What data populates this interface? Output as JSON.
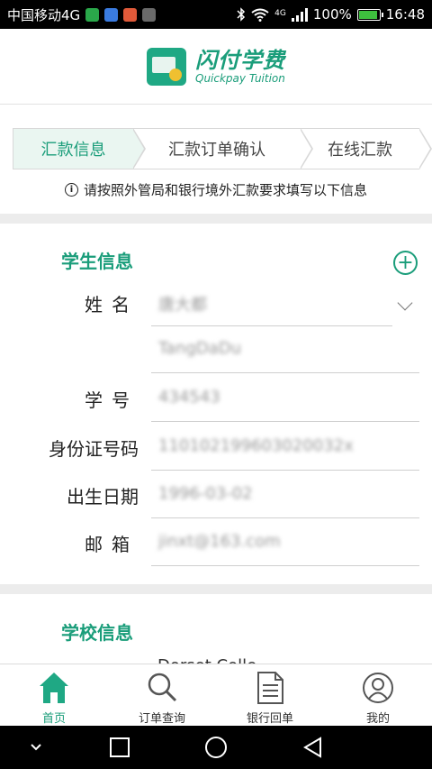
{
  "statusbar": {
    "carrier": "中国移动4G",
    "signal_label": "4G",
    "battery": "100%",
    "time": "16:48",
    "app_icon_colors": [
      "#2aa84a",
      "#3a7be0",
      "#e05a3a",
      "#6a6a6a"
    ]
  },
  "header": {
    "logo_cn": "闪付学费",
    "logo_en": "Quickpay Tuition"
  },
  "steps": [
    {
      "label": "汇款信息",
      "active": true
    },
    {
      "label": "汇款订单确认",
      "active": false
    },
    {
      "label": "在线汇款",
      "active": false
    }
  ],
  "notice": {
    "icon_text": "i",
    "text": "请按照外管局和银行境外汇款要求填写以下信息"
  },
  "student_section": {
    "title": "学生信息",
    "add_symbol": "+",
    "fields": [
      {
        "key": "name",
        "label": "姓名",
        "value": "唐大都"
      },
      {
        "key": "pinyin",
        "label": "",
        "value": "TangDaDu"
      },
      {
        "key": "student_id",
        "label": "学号",
        "value": "434543"
      },
      {
        "key": "id_number",
        "label": "身份证号码",
        "value": "110102199603020032x"
      },
      {
        "key": "birthdate",
        "label": "出生日期",
        "value": "1996-03-02"
      },
      {
        "key": "email",
        "label": "邮箱",
        "value": "jinxt@163.com"
      }
    ]
  },
  "school_section": {
    "title": "学校信息",
    "partial_value": "Dorset Colle"
  },
  "tabbar": {
    "items": [
      {
        "label": "首页",
        "icon": "home-icon",
        "active": true
      },
      {
        "label": "订单查询",
        "icon": "search-icon",
        "active": false
      },
      {
        "label": "银行回单",
        "icon": "document-icon",
        "active": false
      },
      {
        "label": "我的",
        "icon": "user-icon",
        "active": false
      }
    ]
  },
  "colors": {
    "accent": "#1a9d7a",
    "step_active_bg": "#eaf6f1",
    "divider": "#ececec"
  }
}
